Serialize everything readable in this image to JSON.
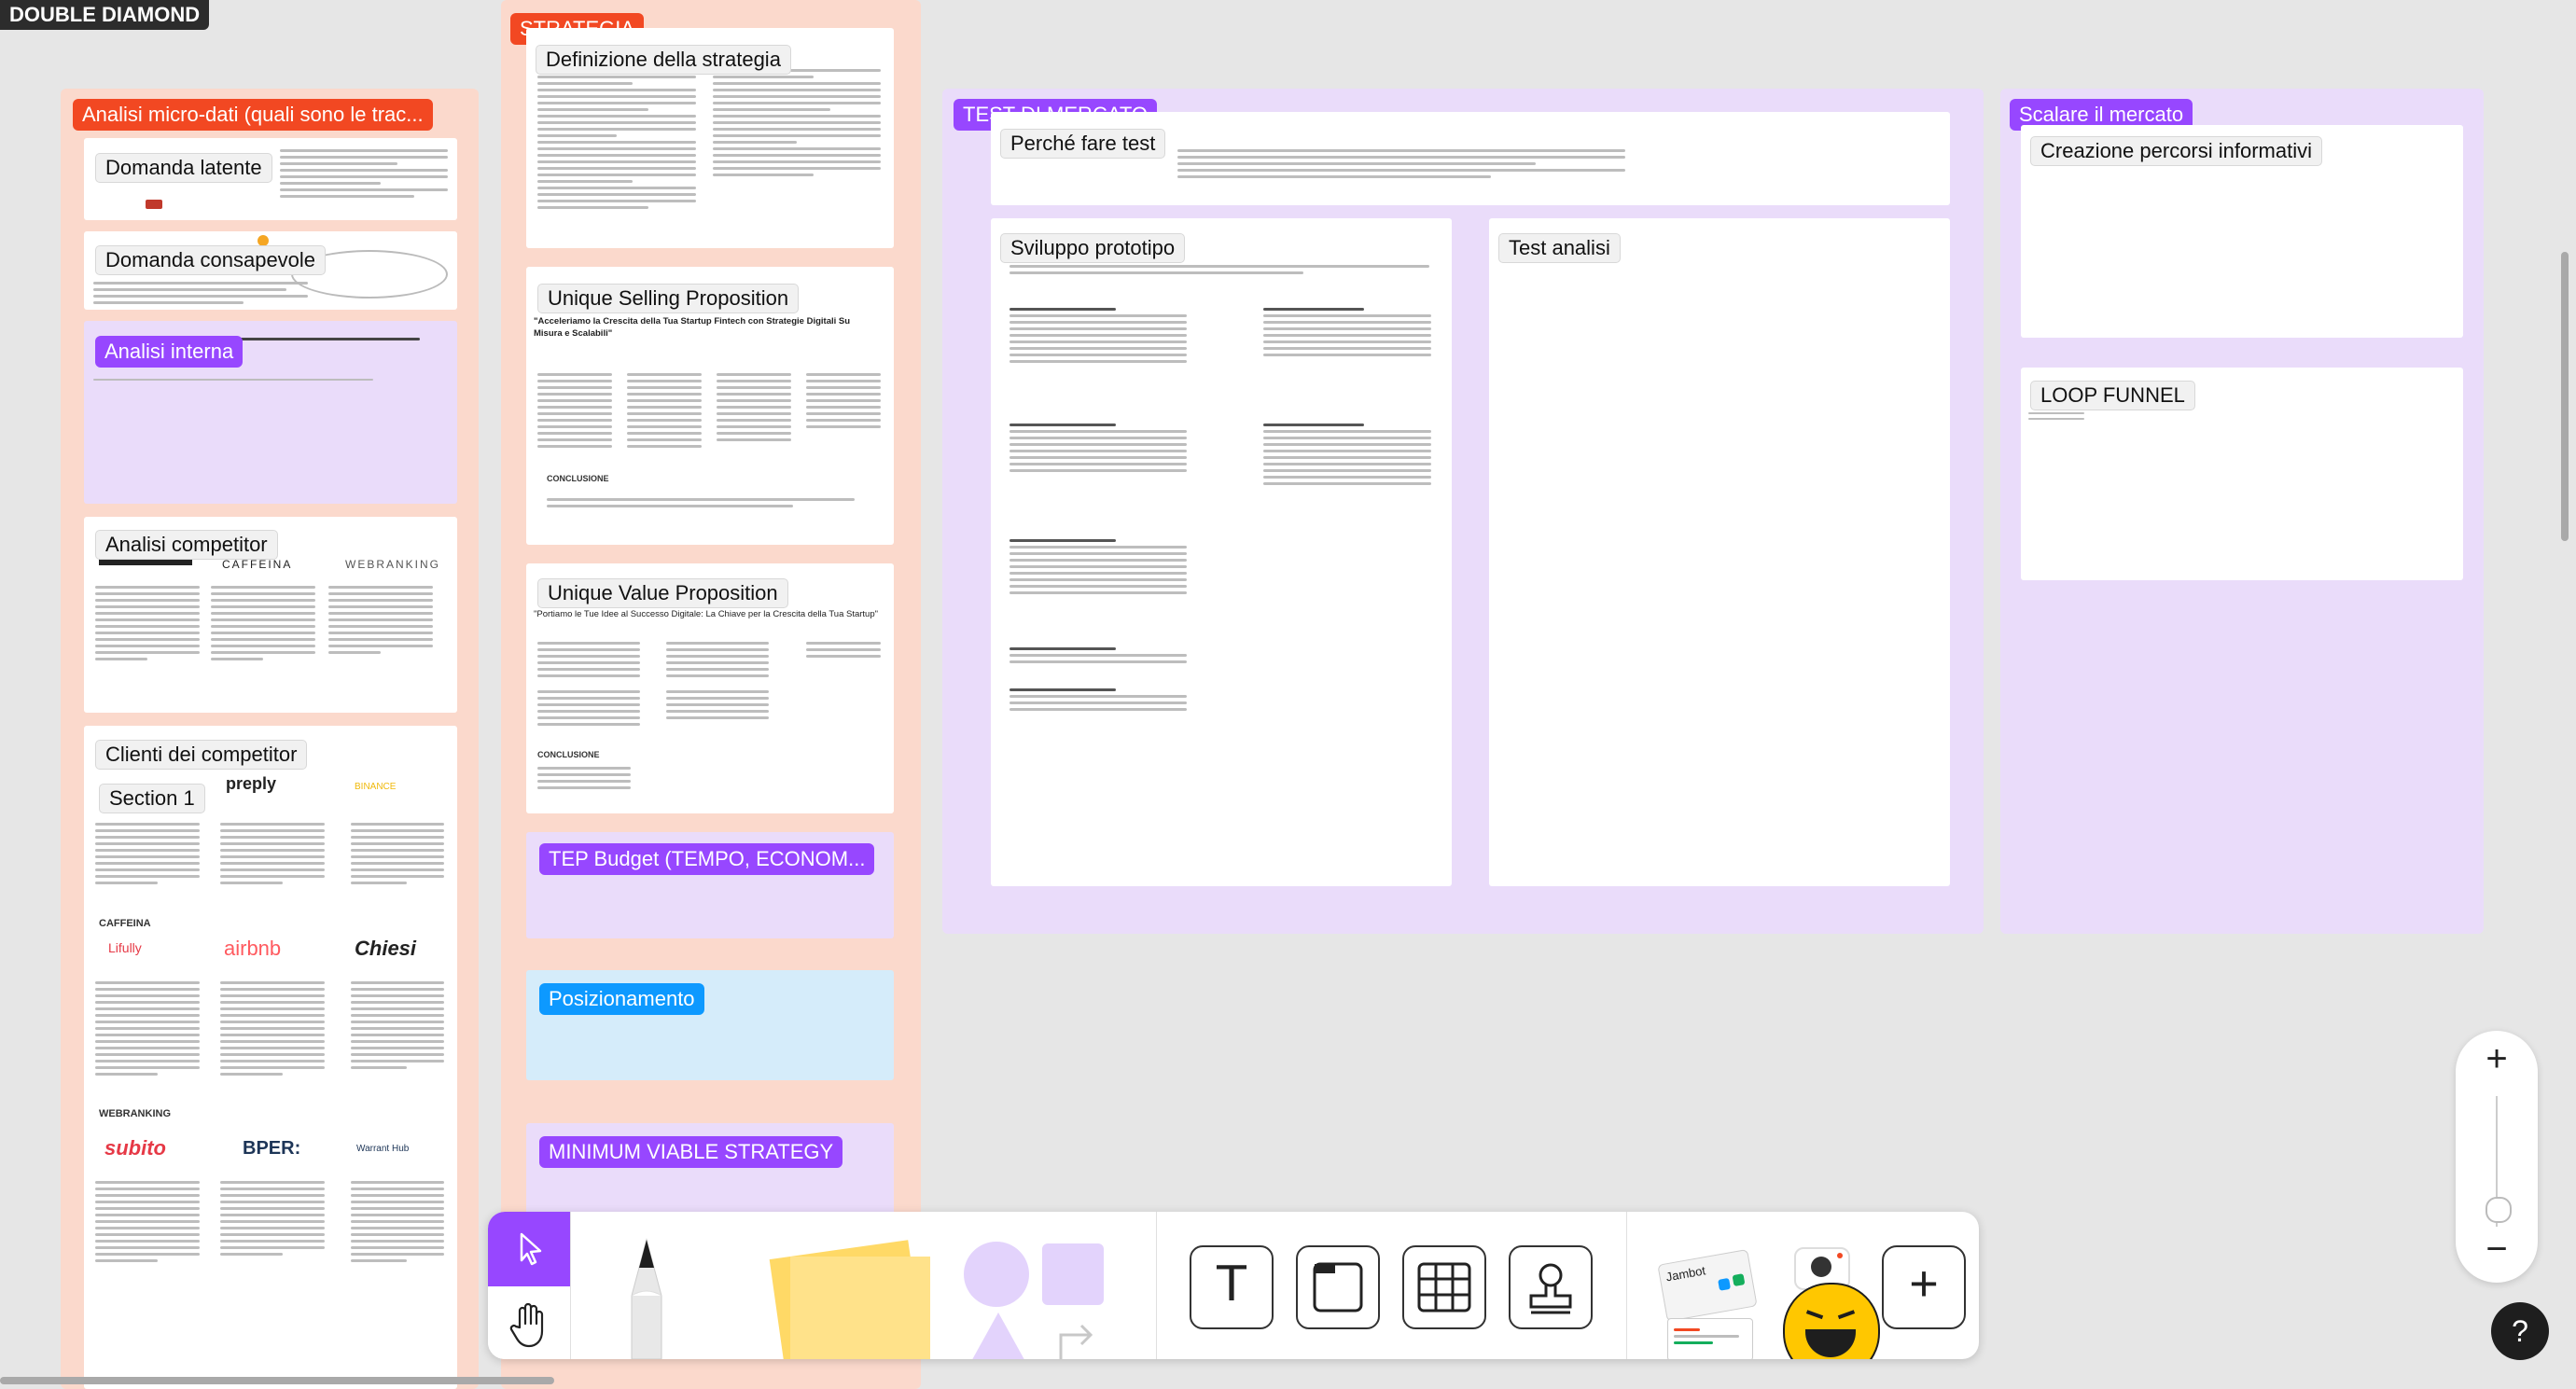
{
  "board": {
    "top_label": "DOUBLE DIAMOND"
  },
  "sections": {
    "analisi": {
      "title": "Analisi micro-dati (quali sono le trac...",
      "cards": {
        "domanda_latente": "Domanda latente",
        "domanda_consapevole": "Domanda consapevole",
        "analisi_interna": "Analisi interna",
        "analisi_competitor": "Analisi competitor",
        "clienti_competitor": "Clienti dei competitor",
        "section1": "Section 1"
      },
      "competitor_logos": [
        "CAFFEINA",
        "WEBRANKING"
      ],
      "client_logos": [
        "preply",
        "BINANCE",
        "Lifully",
        "airbnb",
        "Chiesi",
        "subito",
        "BPER:",
        "Warrant Hub"
      ],
      "client_groups": [
        "CAFFEINA",
        "WEBRANKING"
      ]
    },
    "strategia": {
      "title": "STRATEGIA",
      "cards": {
        "definizione": "Definizione della strategia",
        "usp": "Unique Selling Proposition",
        "usp_quote": "\"Acceleriamo la Crescita della Tua Startup Fintech con Strategie Digitali Su Misura e Scalabili\"",
        "usp_conclusione": "CONCLUSIONE",
        "uvp": "Unique Value Proposition",
        "uvp_quote": "\"Portiamo le Tue Idee al Successo Digitale: La Chiave per la Crescita della Tua Startup\"",
        "uvp_conclusione": "CONCLUSIONE",
        "tep_budget": "TEP Budget (TEMPO, ECONOM...",
        "posizionamento": "Posizionamento",
        "mvs": "MINIMUM VIABLE STRATEGY"
      }
    },
    "test": {
      "title": "TEST DI MERCATO",
      "cards": {
        "perche": "Perché fare test",
        "sviluppo": "Sviluppo prototipo",
        "test_analisi": "Test analisi"
      }
    },
    "scalare": {
      "title": "Scalare il mercato",
      "cards": {
        "percorsi": "Creazione percorsi informativi",
        "loop": "LOOP FUNNEL"
      }
    }
  },
  "toolbar": {
    "tools": [
      "select-tool",
      "hand-tool",
      "pen-tool",
      "sticky-notes",
      "shapes",
      "connector",
      "text-tool",
      "section-tool",
      "table-tool",
      "stamp-tool",
      "widgets",
      "emoji",
      "more-tools"
    ],
    "text_glyph": "T",
    "plus_glyph": "+",
    "widget_label": "Jambot"
  },
  "zoom": {
    "plus": "+",
    "minus": "−",
    "level": 0.22
  },
  "help": {
    "label": "?"
  },
  "colors": {
    "red_section": "#fbd9cc",
    "purple_section": "#eadcfa",
    "blue_section": "#d5ecfa",
    "tag_red": "#f24822",
    "tag_purple": "#9747ff",
    "tag_blue": "#0d99ff",
    "tool_active": "#9747ff"
  }
}
